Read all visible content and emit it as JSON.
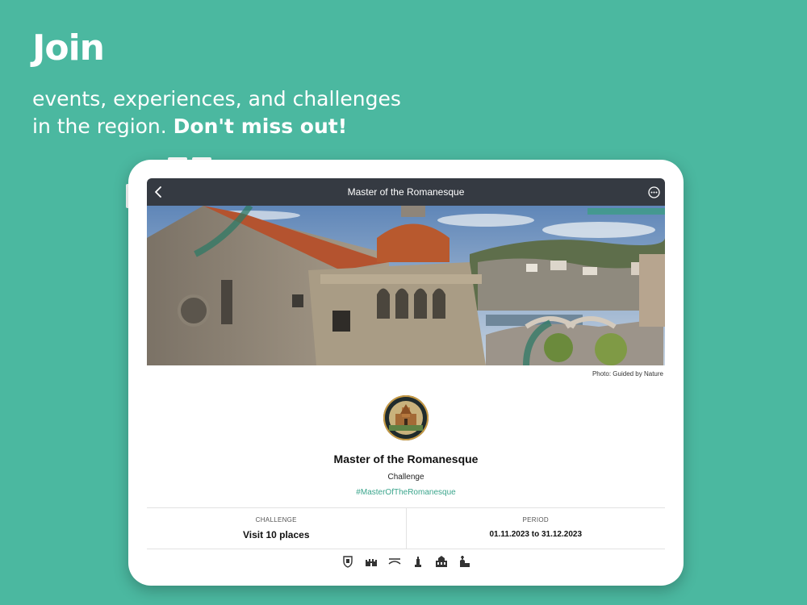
{
  "promo": {
    "headline": "Join",
    "tagline_plain": "events, experiences, and challenges in the region. ",
    "tagline_bold": "Don't miss out!"
  },
  "app": {
    "nav_title": "Master of the Romanesque",
    "back_icon": "chevron-left-icon",
    "more_icon": "ellipsis-circle-icon",
    "photo_credit": "Photo: Guided by Nature",
    "title": "Master of the Romanesque",
    "type": "Challenge",
    "hashtag": "#MasterOfTheRomanesque",
    "stats": [
      {
        "label": "CHALLENGE",
        "value": "Visit 10 places"
      },
      {
        "label": "PERIOD",
        "value": "01.11.2023 to 31.12.2023"
      }
    ],
    "category_icons": [
      "shield-icon",
      "castle-icon",
      "bridge-icon",
      "monument-icon",
      "palace-icon",
      "church-icon"
    ]
  },
  "colors": {
    "background": "#4bb8a0",
    "navbar": "#353a42",
    "accent": "#3ba58c"
  }
}
